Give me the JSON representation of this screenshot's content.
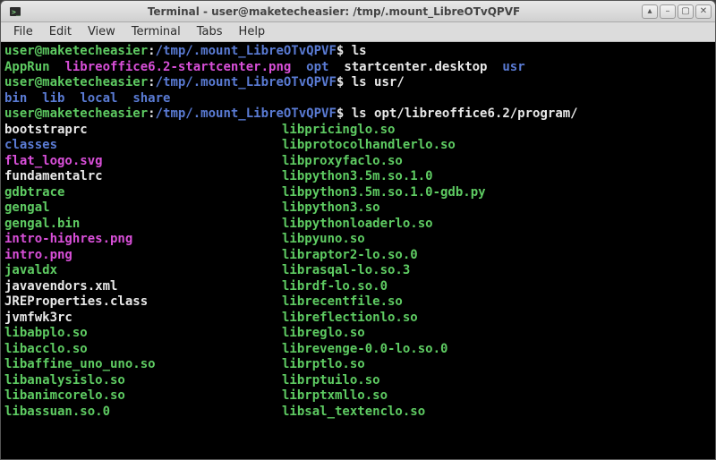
{
  "window": {
    "title": "Terminal - user@maketecheasier: /tmp/.mount_LibreOTvQPVF"
  },
  "menu": {
    "file": "File",
    "edit": "Edit",
    "view": "View",
    "terminal": "Terminal",
    "tabs": "Tabs",
    "help": "Help"
  },
  "prompt": {
    "user": "user@maketecheasier",
    "sep": ":",
    "path": "/tmp/.mount_LibreOTvQPVF",
    "sym": "$"
  },
  "cmds": {
    "ls": "ls",
    "ls_usr": "ls usr/",
    "ls_opt": "ls opt/libreoffice6.2/program/"
  },
  "out1": {
    "a": "AppRun",
    "b": "libreoffice6.2-startcenter.png",
    "c": "opt",
    "d": "startcenter.desktop",
    "e": "usr"
  },
  "out2": {
    "a": "bin",
    "b": "lib",
    "c": "local",
    "d": "share"
  },
  "listing": {
    "left": [
      {
        "t": "bootstraprc",
        "c": "normal"
      },
      {
        "t": "classes",
        "c": "dir"
      },
      {
        "t": "flat_logo.svg",
        "c": "img"
      },
      {
        "t": "fundamentalrc",
        "c": "normal"
      },
      {
        "t": "gdbtrace",
        "c": "exec"
      },
      {
        "t": "gengal",
        "c": "exec"
      },
      {
        "t": "gengal.bin",
        "c": "exec"
      },
      {
        "t": "intro-highres.png",
        "c": "img"
      },
      {
        "t": "intro.png",
        "c": "img"
      },
      {
        "t": "javaldx",
        "c": "exec"
      },
      {
        "t": "javavendors.xml",
        "c": "normal"
      },
      {
        "t": "JREProperties.class",
        "c": "normal"
      },
      {
        "t": "jvmfwk3rc",
        "c": "normal"
      },
      {
        "t": "libabplo.so",
        "c": "exec"
      },
      {
        "t": "libacclo.so",
        "c": "exec"
      },
      {
        "t": "libaffine_uno_uno.so",
        "c": "exec"
      },
      {
        "t": "libanalysislo.so",
        "c": "exec"
      },
      {
        "t": "libanimcorelo.so",
        "c": "exec"
      },
      {
        "t": "libassuan.so.0",
        "c": "exec"
      }
    ],
    "right": [
      {
        "t": "libpricinglo.so",
        "c": "exec"
      },
      {
        "t": "libprotocolhandlerlo.so",
        "c": "exec"
      },
      {
        "t": "libproxyfaclo.so",
        "c": "exec"
      },
      {
        "t": "libpython3.5m.so.1.0",
        "c": "exec"
      },
      {
        "t": "libpython3.5m.so.1.0-gdb.py",
        "c": "exec"
      },
      {
        "t": "libpython3.so",
        "c": "exec"
      },
      {
        "t": "libpythonloaderlo.so",
        "c": "exec"
      },
      {
        "t": "libpyuno.so",
        "c": "exec"
      },
      {
        "t": "libraptor2-lo.so.0",
        "c": "exec"
      },
      {
        "t": "librasqal-lo.so.3",
        "c": "exec"
      },
      {
        "t": "librdf-lo.so.0",
        "c": "exec"
      },
      {
        "t": "librecentfile.so",
        "c": "exec"
      },
      {
        "t": "libreflectionlo.so",
        "c": "exec"
      },
      {
        "t": "libreglo.so",
        "c": "exec"
      },
      {
        "t": "librevenge-0.0-lo.so.0",
        "c": "exec"
      },
      {
        "t": "librptlo.so",
        "c": "exec"
      },
      {
        "t": "librptuilo.so",
        "c": "exec"
      },
      {
        "t": "librptxmllo.so",
        "c": "exec"
      },
      {
        "t": "libsal_textenclo.so",
        "c": "exec"
      }
    ]
  }
}
